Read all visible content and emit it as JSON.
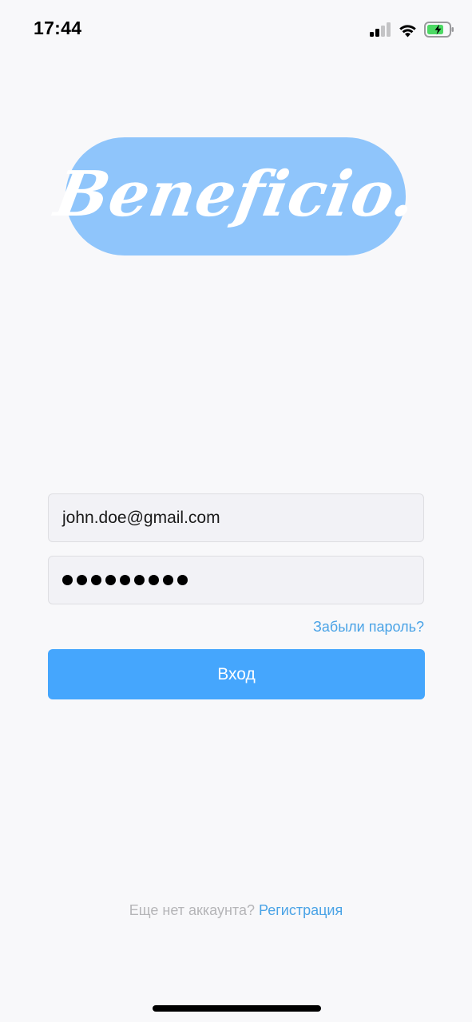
{
  "status_bar": {
    "time": "17:44",
    "signal_icon": "cellular-signal-icon",
    "wifi_icon": "wifi-icon",
    "battery_icon": "battery-charging-icon",
    "battery_color": "#4cd964"
  },
  "logo": {
    "text": "Beneficio.",
    "background_color": "#8fc5fb"
  },
  "form": {
    "email_value": "john.doe@gmail.com",
    "password_mask_length": 9,
    "forgot_label": "Забыли пароль?",
    "login_label": "Вход",
    "accent_color": "#45a6fd"
  },
  "footer": {
    "prompt": "Еще нет аккаунта?",
    "signup_label": "Регистрация"
  }
}
